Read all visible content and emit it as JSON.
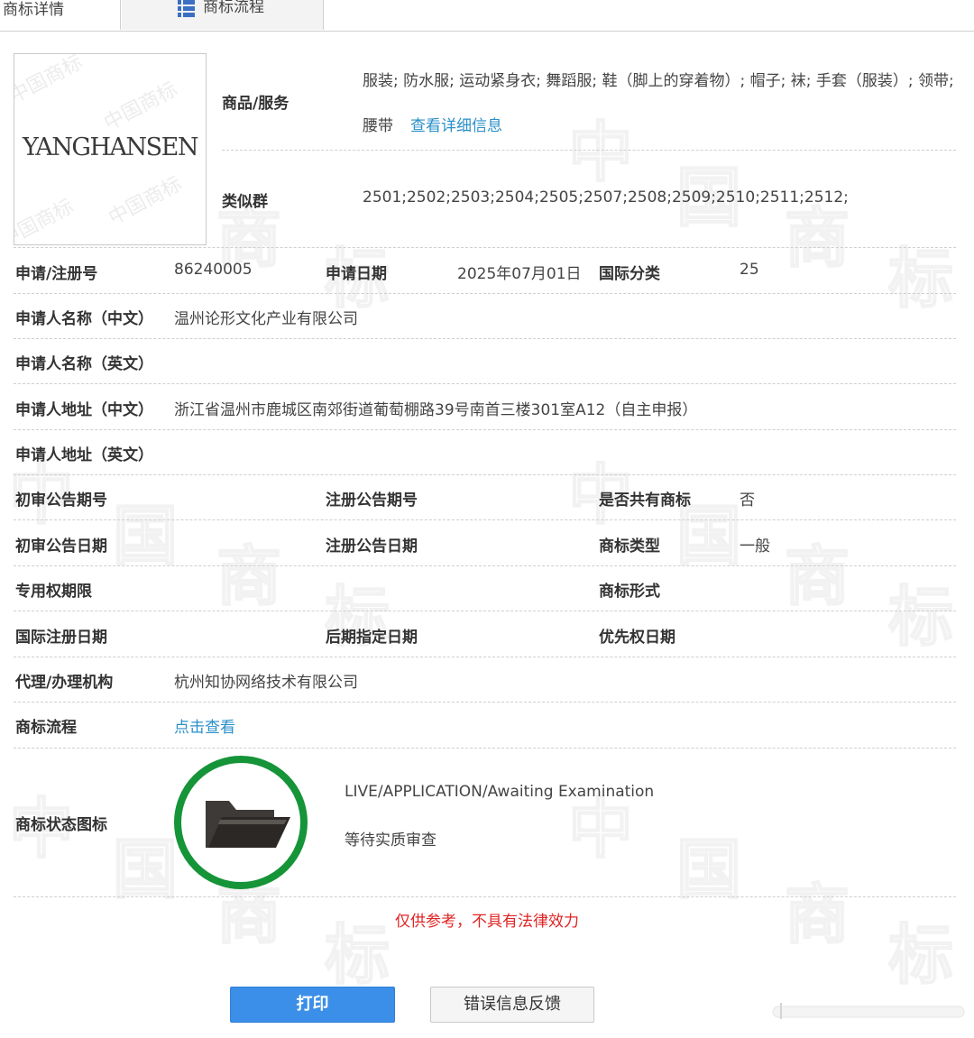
{
  "tabs": [
    {
      "label": "商标详情"
    },
    {
      "label": "商标流程"
    }
  ],
  "logo": {
    "mark_text": "YANGHANSEN",
    "watermark": "中国商标"
  },
  "goods": {
    "label": "商品/服务",
    "line1": "服装; 防水服; 运动紧身衣; 舞蹈服; 鞋（脚上的穿着物）; 帽子; 袜; 手套（服装）; 领带;",
    "line2": "腰带",
    "detail_link": "查看详细信息"
  },
  "similar_group": {
    "label": "类似群",
    "value": "2501;2502;2503;2504;2505;2507;2508;2509;2510;2511;2512;"
  },
  "fields": {
    "reg_no_label": "申请/注册号",
    "reg_no": "86240005",
    "apply_date_label": "申请日期",
    "apply_date": "2025年07月01日",
    "intl_class_label": "国际分类",
    "intl_class": "25",
    "applicant_cn_label": "申请人名称（中文）",
    "applicant_cn": "温州论形文化产业有限公司",
    "applicant_en_label": "申请人名称（英文）",
    "applicant_en": "",
    "address_cn_label": "申请人地址（中文）",
    "address_cn": "浙江省温州市鹿城区南郊街道葡萄棚路39号南首三楼301室A12（自主申报）",
    "address_en_label": "申请人地址（英文）",
    "address_en": "",
    "prelim_no_label": "初审公告期号",
    "prelim_no": "",
    "reg_notice_no_label": "注册公告期号",
    "reg_notice_no": "",
    "shared_label": "是否共有商标",
    "shared": "否",
    "prelim_date_label": "初审公告日期",
    "prelim_date": "",
    "reg_notice_date_label": "注册公告日期",
    "reg_notice_date": "",
    "mark_type_label": "商标类型",
    "mark_type": "一般",
    "exclusive_term_label": "专用权期限",
    "exclusive_term": "",
    "mark_form_label": "商标形式",
    "mark_form": "",
    "intl_reg_date_label": "国际注册日期",
    "intl_reg_date": "",
    "later_date_label": "后期指定日期",
    "later_date": "",
    "priority_date_label": "优先权日期",
    "priority_date": "",
    "agent_label": "代理/办理机构",
    "agent": "杭州知协网络技术有限公司",
    "flow_label": "商标流程",
    "flow_link": "点击查看"
  },
  "status": {
    "label": "商标状态图标",
    "en": "LIVE/APPLICATION/Awaiting Examination",
    "cn": "等待实质审查",
    "icon": "open-folder-icon",
    "ring_color": "#159438"
  },
  "notice": "仅供参考，不具有法律效力",
  "buttons": {
    "print": "打印",
    "feedback": "错误信息反馈"
  },
  "watermark_chars": [
    "中",
    "国",
    "商",
    "标"
  ]
}
